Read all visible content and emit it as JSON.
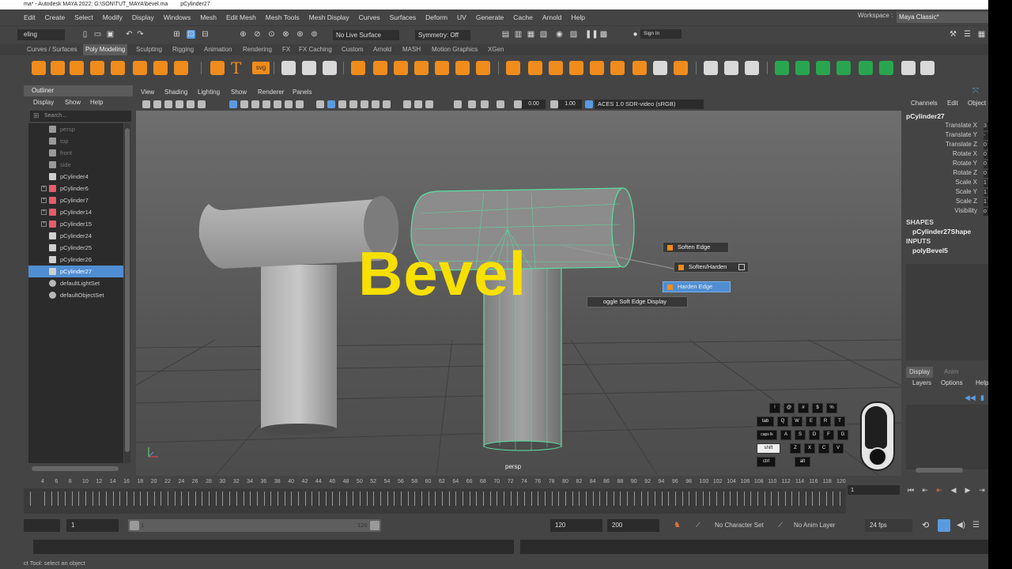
{
  "window": {
    "title": "ma* - Autodesk MAYA 2022: G:\\SON\\TUT_MAYA\\bevel.ma",
    "project": "pCylinder27"
  },
  "menubar": {
    "items": [
      "Edit",
      "Create",
      "Select",
      "Modify",
      "Display",
      "Windows",
      "Mesh",
      "Edit Mesh",
      "Mesh Tools",
      "Mesh Display",
      "Curves",
      "Surfaces",
      "Deform",
      "UV",
      "Generate",
      "Cache",
      "Arnold",
      "Help"
    ],
    "workspace_label": "Workspace :",
    "workspace_value": "Maya Classic*"
  },
  "statusline": {
    "mode": "eling",
    "live_surface": "No Live Surface",
    "symmetry": "Symmetry: Off",
    "sign_in": "Sign In"
  },
  "shelf": {
    "tabs": [
      "Curves / Surfaces",
      "Poly Modeling",
      "Sculpting",
      "Rigging",
      "Animation",
      "Rendering",
      "FX",
      "FX Caching",
      "Custom",
      "Arnold",
      "MASH",
      "Motion Graphics",
      "XGen"
    ],
    "active_tab": "Poly Modeling",
    "text_icons": [
      "T",
      "svg"
    ]
  },
  "outliner": {
    "title": "Outliner",
    "menu": [
      "Display",
      "Show",
      "Help"
    ],
    "search_placeholder": "Search...",
    "items": [
      {
        "label": "persp",
        "dim": true,
        "expand": false,
        "type": "camera"
      },
      {
        "label": "top",
        "dim": true,
        "expand": false,
        "type": "camera"
      },
      {
        "label": "front",
        "dim": true,
        "expand": false,
        "type": "camera"
      },
      {
        "label": "side",
        "dim": true,
        "expand": false,
        "type": "camera"
      },
      {
        "label": "pCylinder4",
        "dim": false,
        "expand": false,
        "type": "mesh"
      },
      {
        "label": "pCylinder6",
        "dim": false,
        "expand": true,
        "type": "group"
      },
      {
        "label": "pCylinder7",
        "dim": false,
        "expand": true,
        "type": "group"
      },
      {
        "label": "pCylinder14",
        "dim": false,
        "expand": true,
        "type": "group"
      },
      {
        "label": "pCylinder15",
        "dim": false,
        "expand": true,
        "type": "group"
      },
      {
        "label": "pCylinder24",
        "dim": false,
        "expand": false,
        "type": "mesh"
      },
      {
        "label": "pCylinder25",
        "dim": false,
        "expand": false,
        "type": "mesh"
      },
      {
        "label": "pCylinder26",
        "dim": false,
        "expand": false,
        "type": "mesh"
      },
      {
        "label": "pCylinder27",
        "dim": false,
        "expand": false,
        "type": "mesh",
        "selected": true
      },
      {
        "label": "defaultLightSet",
        "dim": false,
        "expand": false,
        "type": "set"
      },
      {
        "label": "defaultObjectSet",
        "dim": false,
        "expand": false,
        "type": "set"
      }
    ]
  },
  "viewport": {
    "menu": [
      "View",
      "Shading",
      "Lighting",
      "Show",
      "Renderer",
      "Panels"
    ],
    "field_a": "0.00",
    "field_b": "1.00",
    "color_space": "ACES 1.0 SDR-video (sRGB)",
    "camera_label": "persp",
    "overlay_title": "Bevel",
    "marking_menu": {
      "soften": "Soften Edge",
      "soften_harden": "Soften/Harden",
      "harden": "Harden Edge",
      "toggle": "oggle Soft Edge Display"
    },
    "keys": [
      "!",
      "@",
      "#",
      "$",
      "%",
      "tab",
      "Q",
      "W",
      "E",
      "R",
      "T",
      "caps lk",
      "A",
      "S",
      "D",
      "F",
      "G",
      "shift",
      "Z",
      "X",
      "C",
      "V",
      "ctrl",
      "alt"
    ]
  },
  "channelbox": {
    "menu": [
      "Channels",
      "Edit",
      "Object"
    ],
    "object": "pCylinder27",
    "attributes": [
      {
        "name": "Translate X",
        "value": "3"
      },
      {
        "name": "Translate Y",
        "value": "-"
      },
      {
        "name": "Translate Z",
        "value": "0"
      },
      {
        "name": "Rotate X",
        "value": "0"
      },
      {
        "name": "Rotate Y",
        "value": "0"
      },
      {
        "name": "Rotate Z",
        "value": "0"
      },
      {
        "name": "Scale X",
        "value": "1"
      },
      {
        "name": "Scale Y",
        "value": "1"
      },
      {
        "name": "Scale Z",
        "value": "1"
      },
      {
        "name": "Visibility",
        "value": "o"
      }
    ],
    "shapes_label": "SHAPES",
    "shape_node": "pCylinder27Shape",
    "inputs_label": "INPUTS",
    "input_node": "polyBevel5"
  },
  "layers": {
    "tabs": [
      "Display",
      "Anim"
    ],
    "menu": [
      "Layers",
      "Options",
      "Help"
    ]
  },
  "timeslider": {
    "ticks": [
      "4",
      "6",
      "8",
      "10",
      "12",
      "14",
      "16",
      "18",
      "20",
      "22",
      "24",
      "26",
      "28",
      "30",
      "32",
      "34",
      "36",
      "38",
      "40",
      "42",
      "44",
      "46",
      "48",
      "50",
      "52",
      "54",
      "56",
      "58",
      "60",
      "62",
      "64",
      "66",
      "68",
      "70",
      "72",
      "74",
      "76",
      "78",
      "80",
      "82",
      "84",
      "86",
      "88",
      "90",
      "92",
      "94",
      "96",
      "98",
      "100",
      "102",
      "104",
      "106",
      "108",
      "110",
      "112",
      "114",
      "116",
      "118",
      "120"
    ],
    "current_frame": "1"
  },
  "rangeslider": {
    "start": "1",
    "range_start": "1",
    "range_end": "120",
    "end": "120",
    "anim_end": "200",
    "character_set": "No Character Set",
    "anim_layer": "No Anim Layer",
    "fps": "24 fps"
  },
  "helpline": {
    "text": "ct Tool: select an object"
  }
}
